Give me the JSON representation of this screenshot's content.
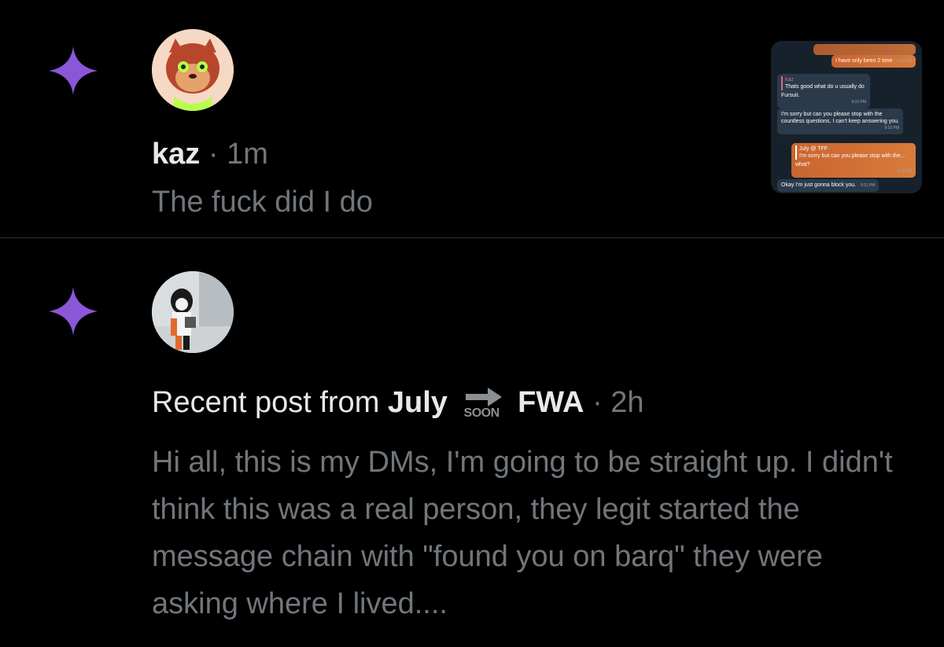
{
  "notification_1": {
    "user": "kaz",
    "dot": "·",
    "time": "1m",
    "text": "The fuck did I do",
    "thumbnail": {
      "messages": [
        {
          "from": "out",
          "text": "I have only been 2 time",
          "time": "9:07 PM"
        },
        {
          "from": "in",
          "reply_name": "kaz",
          "reply_text": "Thats good what do u usually do",
          "text": "Fursuit.",
          "time": "9:10 PM"
        },
        {
          "from": "in",
          "text": "I'm sorry but can you please stop with the countless questions, I can't keep answering you.",
          "time": "9:10 PM"
        },
        {
          "from": "out",
          "reply_name": "July @ TFF",
          "reply_text": "I'm sorry but can you please stop with the...",
          "text": "what?",
          "time": "9:11 PM"
        },
        {
          "from": "in",
          "text": "Okay I'm just gonna block you.",
          "time": "9:11 PM"
        }
      ]
    }
  },
  "notification_2": {
    "prefix": "Recent post from ",
    "name_part1": "July",
    "soon_label": "SOON",
    "name_part2": "FWA",
    "dot": "·",
    "time": "2h",
    "text": "Hi all, this is my DMs, I'm going to be straight up. I didn't think this was a real person, they legit started the message chain with \"found you on barq\" they were asking where I lived...."
  },
  "colors": {
    "sparkle": "#8b56d8",
    "background": "#000000",
    "primary_text": "#e7e9ea",
    "secondary_text": "#71767b",
    "divider": "#2f3336"
  },
  "icons": {
    "notification_type": "sparkle-icon"
  }
}
